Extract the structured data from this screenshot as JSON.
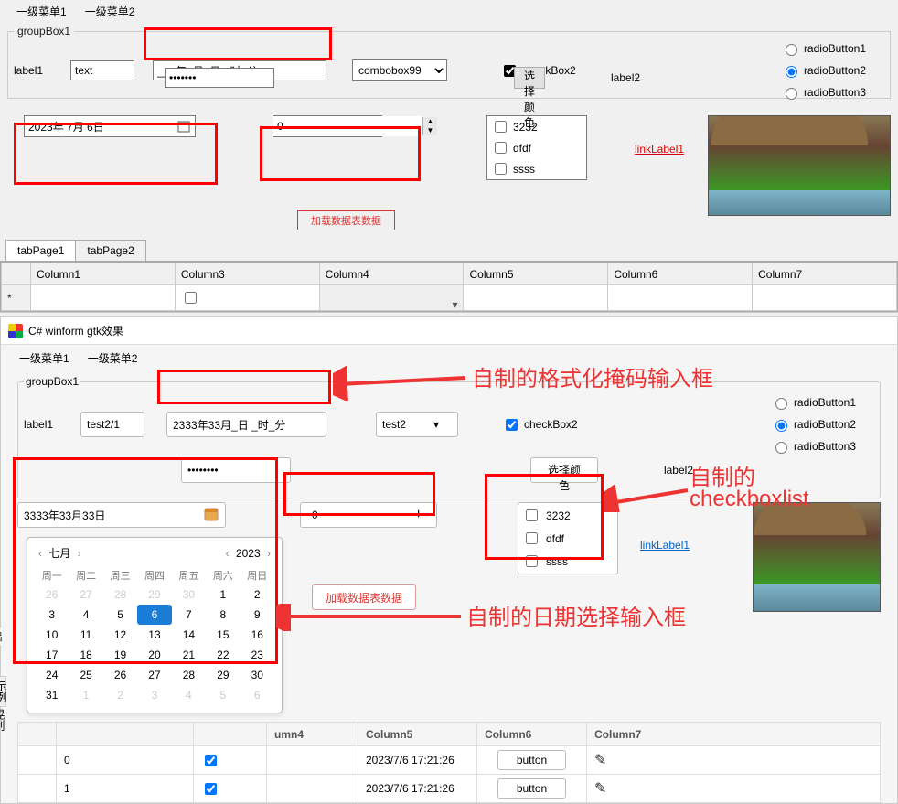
{
  "top": {
    "menu": [
      "一级菜单1",
      "一级菜单2"
    ],
    "groupTitle": "groupBox1",
    "label1": "label1",
    "textValue": "text",
    "masked": "___年_月_日 _时_分",
    "passwordMask": "*******",
    "comboValue": "combobox99",
    "checkBox2": "checkBox2",
    "chooseColor": "选择颜色",
    "label2": "label2",
    "radios": [
      "radioButton1",
      "radioButton2",
      "radioButton3"
    ],
    "radioSel": 1,
    "dateValue": "2023年  7月  6日",
    "numericValue": "0",
    "checklist": [
      "3232",
      "dfdf",
      "ssss"
    ],
    "linkLabel": "linkLabel1",
    "redBtn": "加载数据表数据",
    "tabs": [
      "tabPage1",
      "tabPage2"
    ],
    "columns": [
      "Column1",
      "Column3",
      "Column4",
      "Column5",
      "Column6",
      "Column7"
    ]
  },
  "win2": {
    "title": "C# winform gtk效果",
    "menu": [
      "一级菜单1",
      "一级菜单2"
    ],
    "groupTitle": "groupBox1",
    "label1": "label1",
    "textValue": "test2/1",
    "masked": "2333年33月_日 _时_分",
    "passwordMask": "********",
    "comboValue": "test2",
    "checkBox2": "checkBox2",
    "chooseColor": "选择颜色",
    "label2": "label2",
    "radios": [
      "radioButton1",
      "radioButton2",
      "radioButton3"
    ],
    "radioSel": 1,
    "dateValue": "3333年33月33日",
    "numericValue": "0",
    "checklist": [
      "3232",
      "dfdf",
      "ssss"
    ],
    "linkLabel": "linkLabel1",
    "redBtn": "加载数据表数据",
    "calendar": {
      "monthLabel": "七月",
      "yearLabel": "2023",
      "dow": [
        "周一",
        "周二",
        "周三",
        "周四",
        "周五",
        "周六",
        "周日"
      ],
      "weeks": [
        [
          {
            "d": 26,
            "dim": 1
          },
          {
            "d": 27,
            "dim": 1
          },
          {
            "d": 28,
            "dim": 1
          },
          {
            "d": 29,
            "dim": 1
          },
          {
            "d": 30,
            "dim": 1
          },
          {
            "d": 1
          },
          {
            "d": 2
          }
        ],
        [
          {
            "d": 3
          },
          {
            "d": 4
          },
          {
            "d": 5
          },
          {
            "d": 6,
            "sel": 1
          },
          {
            "d": 7
          },
          {
            "d": 8
          },
          {
            "d": 9
          }
        ],
        [
          {
            "d": 10
          },
          {
            "d": 11
          },
          {
            "d": 12
          },
          {
            "d": 13
          },
          {
            "d": 14
          },
          {
            "d": 15
          },
          {
            "d": 16
          }
        ],
        [
          {
            "d": 17
          },
          {
            "d": 18
          },
          {
            "d": 19
          },
          {
            "d": 20
          },
          {
            "d": 21
          },
          {
            "d": 22
          },
          {
            "d": 23
          }
        ],
        [
          {
            "d": 24
          },
          {
            "d": 25
          },
          {
            "d": 26
          },
          {
            "d": 27
          },
          {
            "d": 28
          },
          {
            "d": 29
          },
          {
            "d": 30
          }
        ],
        [
          {
            "d": 31
          },
          {
            "d": 1,
            "dim": 1
          },
          {
            "d": 2,
            "dim": 1
          },
          {
            "d": 3,
            "dim": 1
          },
          {
            "d": 4,
            "dim": 1
          },
          {
            "d": 5,
            "dim": 1
          },
          {
            "d": 6,
            "dim": 1
          }
        ]
      ]
    },
    "grid": {
      "columns": [
        "",
        "",
        "",
        "umn4",
        "Column5",
        "Column6",
        "Column7"
      ],
      "rows": [
        {
          "c0": "0",
          "chk": true,
          "c4": "2023/7/6 17:21:26",
          "btn": "button"
        },
        {
          "c0": "1",
          "chk": true,
          "c4": "2023/7/6 17:21:26",
          "btn": "button"
        }
      ]
    }
  },
  "annotations": {
    "mask": "自制的格式化掩码输入框",
    "cbl1": "自制的",
    "cbl2": "checkboxlist",
    "date": "自制的日期选择输入框"
  },
  "sideTags": [
    "出",
    "示例",
    "晃别"
  ]
}
